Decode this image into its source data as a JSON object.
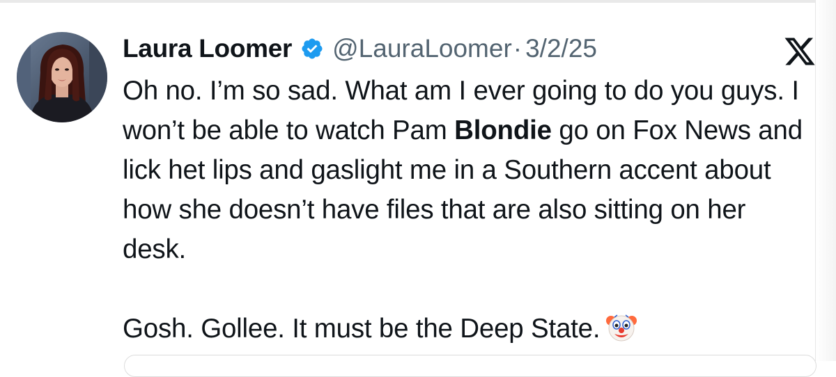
{
  "tweet": {
    "author_name": "Laura Loomer",
    "handle": "@LauraLoomer",
    "separator": "·",
    "date": "3/2/25",
    "verified_icon": "verified-badge-icon",
    "platform_icon": "x-logo-icon",
    "para1_part1": "Oh no. I’m so sad. What am I ever going to do you guys. I won’t be able to watch Pam ",
    "para1_bold": "Blondie",
    "para1_part2": " go on Fox News and lick het lips and gaslight me in a Southern accent about how she doesn’t have files that are also sitting on her desk.",
    "para2": "Gosh. Gollee. It must be the Deep State.",
    "emoji_icon": "clown-face-icon",
    "colors": {
      "verified": "#1d9bf0",
      "text": "#0f1419",
      "secondary": "#536471"
    }
  }
}
